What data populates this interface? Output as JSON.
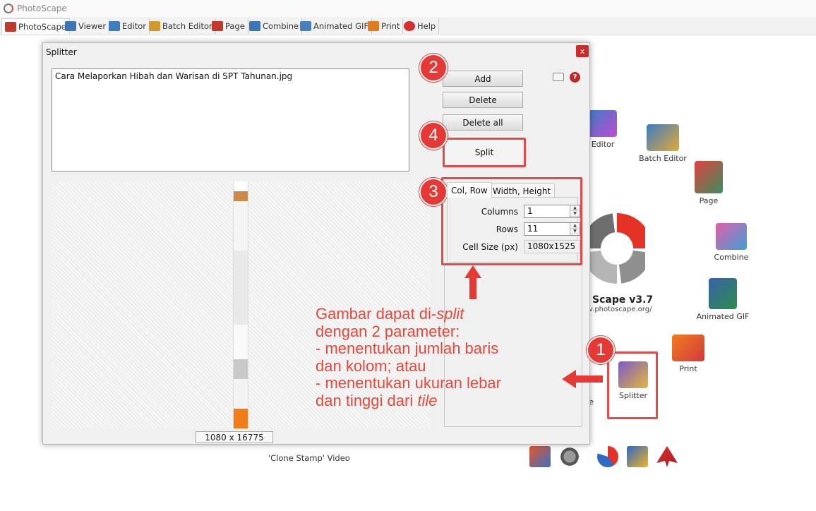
{
  "app": {
    "title": "PhotoScape",
    "version": "Scape v3.7",
    "site": "v.photoscape.org/"
  },
  "tabs": [
    {
      "label": "PhotoScape",
      "color": "#c0392b"
    },
    {
      "label": "Viewer",
      "color": "#3a76b8"
    },
    {
      "label": "Editor",
      "color": "#3c7cc1"
    },
    {
      "label": "Batch Editor",
      "color": "#d29a2c"
    },
    {
      "label": "Page",
      "color": "#c0392b"
    },
    {
      "label": "Combine",
      "color": "#3a76b8"
    },
    {
      "label": "Animated GIF",
      "color": "#4a7fbd"
    },
    {
      "label": "Print",
      "color": "#e07b22"
    },
    {
      "label": "Help",
      "color": "#d32f2f"
    }
  ],
  "desktop_apps": {
    "editor": "Editor",
    "batch_editor": "Batch Editor",
    "page": "Page",
    "combine": "Combine",
    "animated_gif": "Animated GIF",
    "print": "Print",
    "splitter": "Splitter",
    "capture_partial": "ure"
  },
  "footer": {
    "clone_video": "'Clone Stamp' Video"
  },
  "splitter": {
    "title": "Splitter",
    "close": "x",
    "file": "Cara Melaporkan Hibah dan Warisan di SPT Tahunan.jpg",
    "buttons": {
      "add": "Add",
      "delete": "Delete",
      "delete_all": "Delete all",
      "split": "Split"
    },
    "tabs": {
      "col_row": "Col, Row",
      "width_height": "Width, Height"
    },
    "fields": {
      "columns_label": "Columns",
      "columns_value": "1",
      "rows_label": "Rows",
      "rows_value": "11",
      "cell_label": "Cell Size (px)",
      "cell_value": "1080x1525"
    },
    "image_size": "1080 x 16775"
  },
  "annotations": {
    "n1": "1",
    "n2": "2",
    "n3": "3",
    "n4": "4",
    "note_l1a": "Gambar dapat di-",
    "note_l1b": "split",
    "note_l2": "dengan 2 parameter:",
    "note_l3": "- menentukan jumlah baris",
    "note_l4": "dan kolom; atau",
    "note_l5": "- menentukan ukuran lebar",
    "note_l6a": "dan tinggi dari ",
    "note_l6b": "tile",
    "color": "#e53935"
  }
}
